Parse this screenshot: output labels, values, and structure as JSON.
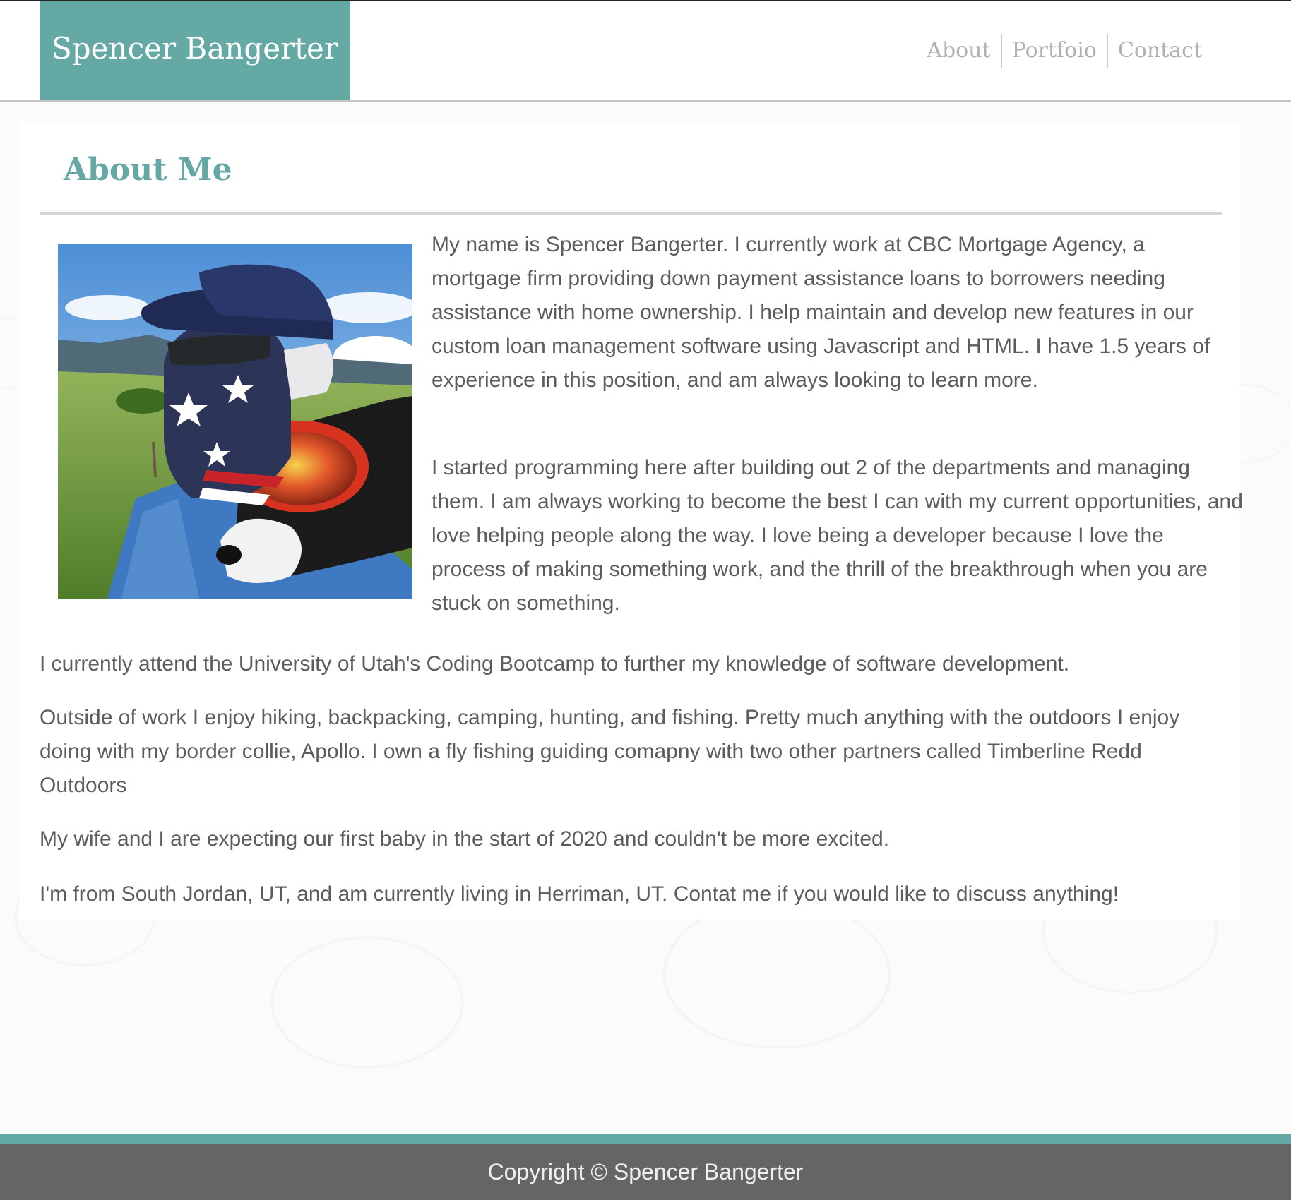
{
  "header": {
    "brand": "Spencer Bangerter",
    "nav": [
      "About",
      "Portfoio",
      "Contact"
    ]
  },
  "main": {
    "title": "About Me",
    "photo_icon": "profile-photo",
    "paragraphs": [
      "My name is Spencer Bangerter. I currently work at CBC Mortgage Agency, a mortgage firm providing down payment assistance loans to borrowers needing assistance with home ownership. I help maintain and develop new features in our custom loan management software using Javascript and HTML. I have 1.5 years of experience in this position, and am always looking to learn more.",
      "I started programming here after building out 2 of the departments and managing them. I am always working to become the best I can with my current opportunities, and love helping people along the way. I love being a developer because I love the process of making something work, and the thrill of the breakthrough when you are stuck on something.",
      "I currently attend the University of Utah's Coding Bootcamp to further my knowledge of software development.",
      "Outside of work I enjoy hiking, backpacking, camping, hunting, and fishing. Pretty much anything with the outdoors I enjoy doing with my border collie, Apollo. I own a fly fishing guiding comapny with two other partners called Timberline Redd Outdoors",
      "My wife and I are expecting our first baby in the start of 2020 and couldn't be more excited.",
      "I'm from South Jordan, UT, and am currently living in Herriman, UT. Contat me if you would like to discuss anything!"
    ]
  },
  "footer": {
    "copyright": "Copyright © Spencer Bangerter"
  },
  "colors": {
    "accent": "#65a9a4",
    "footer": "#656565",
    "text": "#5c5c5c",
    "nav": "#b0b0b0"
  }
}
